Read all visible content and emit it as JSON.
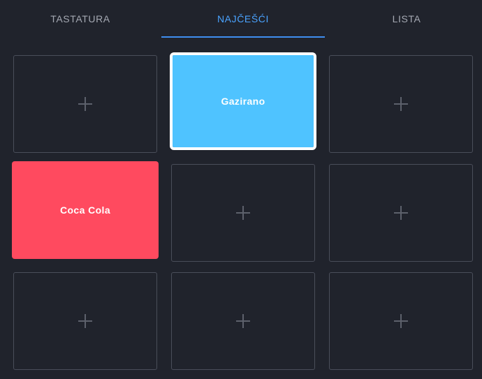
{
  "tabs": [
    {
      "label": "TASTATURA"
    },
    {
      "label": "NAJČEŠĆI"
    },
    {
      "label": "LISTA"
    }
  ],
  "active_tab": 1,
  "grid": {
    "cells": [
      {
        "type": "empty",
        "icon": "plus-icon"
      },
      {
        "type": "item",
        "label": "Gazirano",
        "color": "#4fc3ff",
        "selected": true
      },
      {
        "type": "empty",
        "icon": "plus-icon"
      },
      {
        "type": "item",
        "label": "Coca Cola",
        "color": "#ff4a5f",
        "selected": false
      },
      {
        "type": "empty",
        "icon": "plus-icon"
      },
      {
        "type": "empty",
        "icon": "plus-icon"
      },
      {
        "type": "empty",
        "icon": "plus-icon"
      },
      {
        "type": "empty",
        "icon": "plus-icon"
      },
      {
        "type": "empty",
        "icon": "plus-icon"
      }
    ]
  },
  "colors": {
    "background": "#20232c",
    "active_tab": "#4aa3ff",
    "inactive_tab": "#a4a8b2",
    "cell_border": "#4a4e5a"
  }
}
